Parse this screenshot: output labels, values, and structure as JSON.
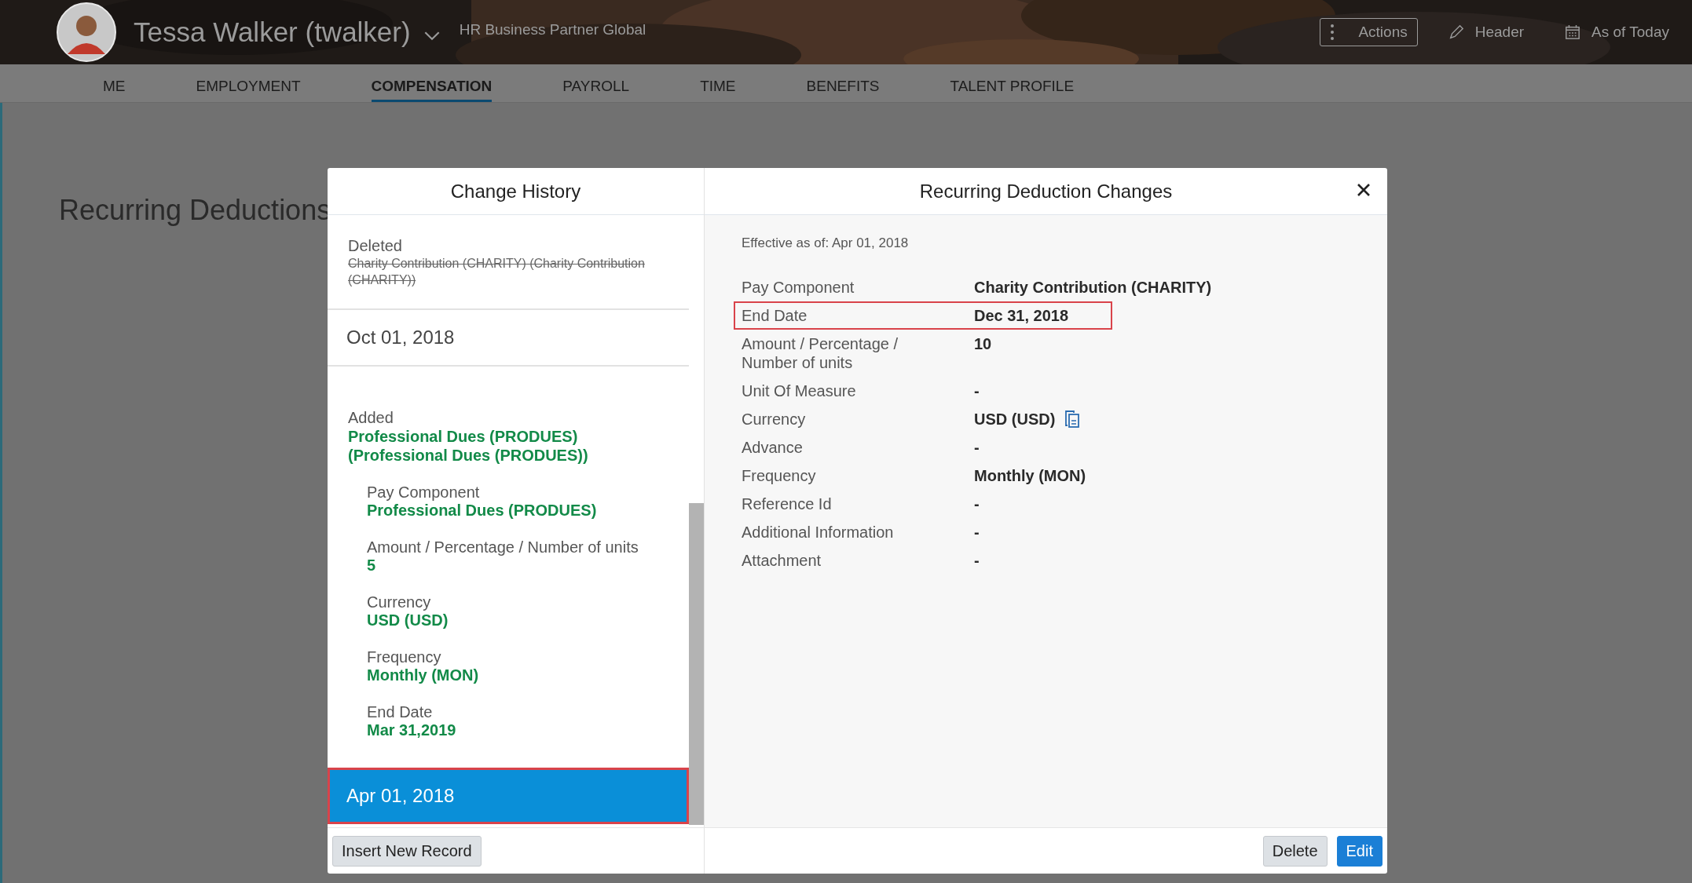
{
  "header": {
    "user_name": "Tessa Walker (twalker)",
    "role": "HR Business Partner Global",
    "actions": [
      {
        "kind": "menu",
        "label": "Actions",
        "bordered": true
      },
      {
        "kind": "edit",
        "label": "Header",
        "bordered": false
      },
      {
        "kind": "calendar",
        "label": "As of Today",
        "bordered": false
      }
    ]
  },
  "tabs": [
    {
      "label": "ME",
      "selected": false
    },
    {
      "label": "EMPLOYMENT",
      "selected": false
    },
    {
      "label": "COMPENSATION",
      "selected": true
    },
    {
      "label": "PAYROLL",
      "selected": false
    },
    {
      "label": "TIME",
      "selected": false
    },
    {
      "label": "BENEFITS",
      "selected": false
    },
    {
      "label": "TALENT PROFILE",
      "selected": false
    }
  ],
  "page_title": "Recurring Deductions",
  "dialog": {
    "history": {
      "title": "Change History",
      "items": [
        {
          "kind": "deleted",
          "action": "Deleted",
          "name": "Charity Contribution (CHARITY) (Charity Contribution (CHARITY))"
        },
        {
          "kind": "date",
          "date": "Oct 01, 2018",
          "selected": false,
          "highlighted": false
        },
        {
          "kind": "added",
          "action": "Added",
          "name": "Professional Dues (PRODUES) (Professional Dues (PRODUES))",
          "fields": [
            {
              "label": "Pay Component",
              "value": "Professional Dues (PRODUES)"
            },
            {
              "label": "Amount / Percentage / Number of units",
              "value": "5"
            },
            {
              "label": "Currency",
              "value": "USD (USD)"
            },
            {
              "label": "Frequency",
              "value": "Monthly (MON)"
            },
            {
              "label": "End Date",
              "value": "Mar 31,2019"
            }
          ]
        },
        {
          "kind": "date",
          "date": "Apr 01, 2018",
          "selected": true,
          "highlighted": true
        }
      ],
      "button": "Insert New Record"
    },
    "details": {
      "title": "Recurring Deduction Changes",
      "effective": "Effective as of: Apr 01, 2018",
      "rows": [
        {
          "label": "Pay Component",
          "value": "Charity Contribution (CHARITY)",
          "highlighted": false
        },
        {
          "label": "End Date",
          "value": "Dec 31, 2018",
          "highlighted": true
        },
        {
          "label": "Amount / Percentage / Number of units",
          "value": "10",
          "highlighted": false
        },
        {
          "label": "Unit Of Measure",
          "value": "-",
          "highlighted": false
        },
        {
          "label": "Currency",
          "value": "USD (USD)",
          "highlighted": false,
          "copyable": true
        },
        {
          "label": "Advance",
          "value": "-",
          "highlighted": false
        },
        {
          "label": "Frequency",
          "value": "Monthly (MON)",
          "highlighted": false
        },
        {
          "label": "Reference Id",
          "value": "-",
          "highlighted": false
        },
        {
          "label": "Additional Information",
          "value": "-",
          "highlighted": false
        },
        {
          "label": "Attachment",
          "value": "-",
          "highlighted": false
        }
      ],
      "buttons": [
        {
          "label": "Delete",
          "primary": false
        },
        {
          "label": "Edit",
          "primary": true
        }
      ]
    }
  }
}
